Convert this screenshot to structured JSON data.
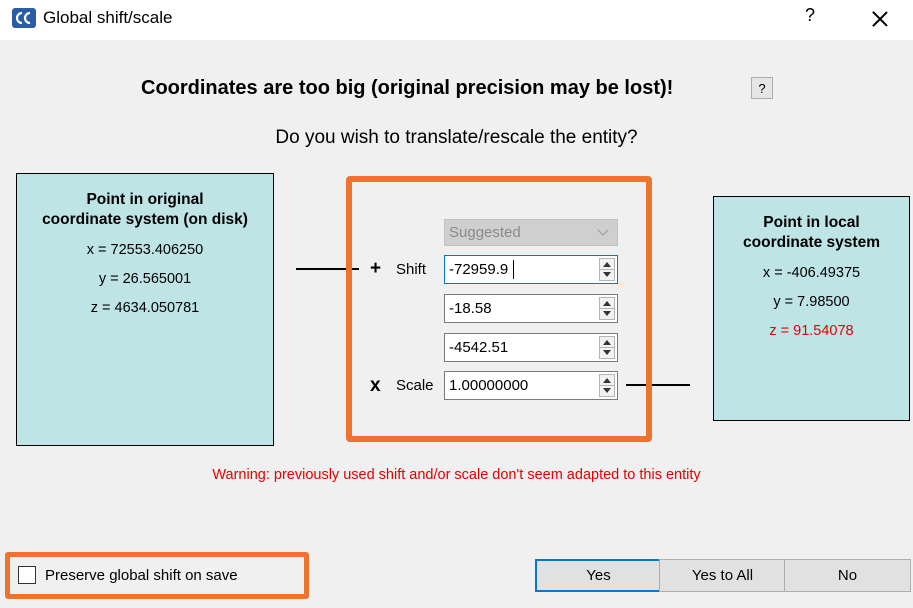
{
  "window": {
    "title": "Global shift/scale",
    "help_label": "?"
  },
  "heading": "Coordinates are too big (original precision may be lost)!",
  "heading_help": "?",
  "question": "Do you wish to translate/rescale the entity?",
  "original": {
    "title_line1": "Point in original",
    "title_line2": "coordinate system (on disk)",
    "x": "x = 72553.406250",
    "y": "y = 26.565001",
    "z": "z = 4634.050781"
  },
  "local": {
    "title_line1": "Point in local",
    "title_line2": "coordinate system",
    "x": "x = -406.49375",
    "y": "y = 7.98500",
    "z": "z = 91.54078"
  },
  "transform": {
    "preset": "Suggested",
    "shift_symbol": "+",
    "shift_label": "Shift",
    "shift_x": "-72959.9",
    "shift_y": "-18.58",
    "shift_z": "-4542.51",
    "scale_symbol": "x",
    "scale_label": "Scale",
    "scale": "1.00000000"
  },
  "warning": "Warning: previously used shift and/or scale don't seem adapted to this entity",
  "preserve_label": "Preserve global shift on save",
  "preserve_checked": false,
  "buttons": {
    "yes": "Yes",
    "yes_all": "Yes to All",
    "no": "No"
  },
  "colors": {
    "accent_highlight": "#ed7430",
    "box_fill": "#bee4e6",
    "warning_red": "#e60000",
    "focus_blue": "#0078d7"
  }
}
